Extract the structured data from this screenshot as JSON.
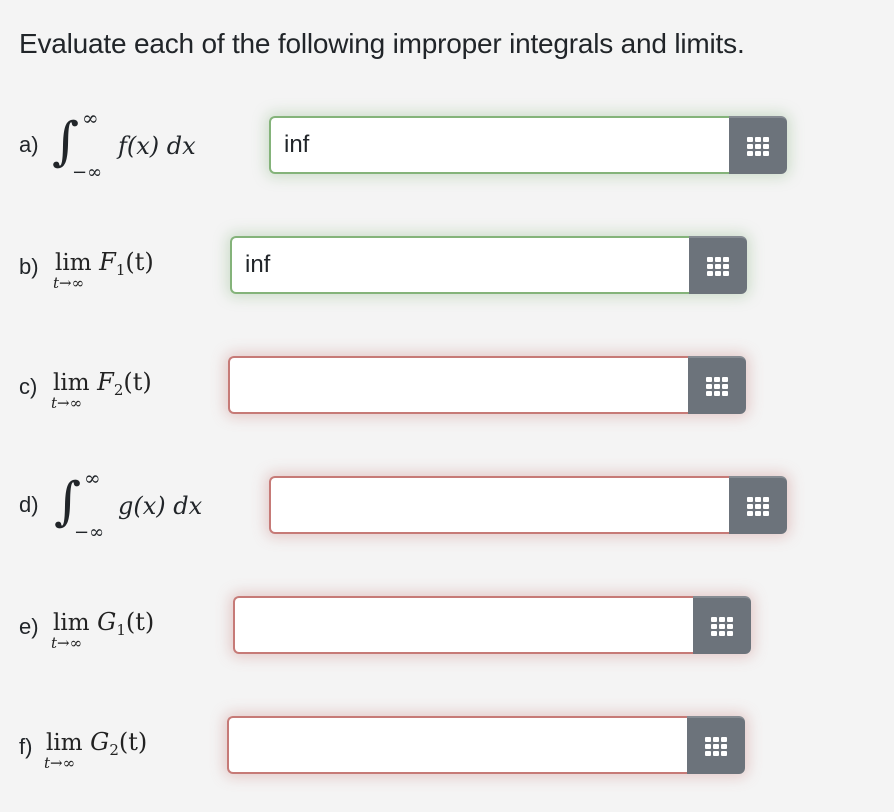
{
  "title": "Evaluate each of the following improper integrals and limits.",
  "questions": [
    {
      "label": "a)",
      "kind": "integral",
      "upper": "∞",
      "lower": "−∞",
      "integrand": "f(x) dx",
      "answer": "inf",
      "status": "correct",
      "button_icon": "grid-icon"
    },
    {
      "label": "b)",
      "kind": "limit",
      "lim": "lim",
      "under": "t→∞",
      "func": "F",
      "subscript": "1",
      "arg": "(t)",
      "answer": "inf",
      "status": "correct",
      "button_icon": "grid-icon"
    },
    {
      "label": "c)",
      "kind": "limit",
      "lim": "lim",
      "under": "t→∞",
      "func": "F",
      "subscript": "2",
      "arg": "(t)",
      "answer": "",
      "status": "incorrect",
      "button_icon": "grid-icon"
    },
    {
      "label": "d)",
      "kind": "integral",
      "upper": "∞",
      "lower": "−∞",
      "integrand": "g(x) dx",
      "answer": "",
      "status": "incorrect",
      "button_icon": "grid-icon"
    },
    {
      "label": "e)",
      "kind": "limit",
      "lim": "lim",
      "under": "t→∞",
      "func": "G",
      "subscript": "1",
      "arg": "(t)",
      "answer": "",
      "status": "incorrect",
      "button_icon": "grid-icon"
    },
    {
      "label": "f)",
      "kind": "limit",
      "lim": "lim",
      "under": "t→∞",
      "func": "G",
      "subscript": "2",
      "arg": "(t)",
      "answer": "",
      "status": "incorrect",
      "button_icon": "grid-icon"
    }
  ],
  "colors": {
    "correct_border": "#84b37a",
    "incorrect_border": "#c67a77",
    "button_bg": "#6c737b",
    "page_bg": "#f4f4f4"
  }
}
